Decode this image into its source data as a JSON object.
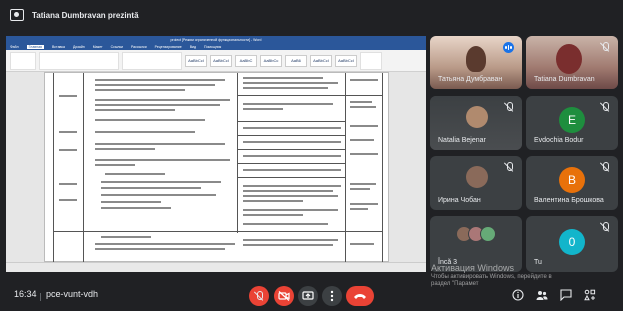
{
  "presenter": {
    "text": "Tatiana Dumbravan prezintă"
  },
  "shared_screen": {
    "word_title": "proiect [Режим ограниченной функциональности] - Word",
    "menu": [
      "Файл",
      "Главная",
      "Вставка",
      "Дизайн",
      "Макет",
      "Ссылки",
      "Рассылки",
      "Рецензирование",
      "Вид",
      "Помощник"
    ],
    "styles": [
      "AaBbCcI",
      "AaBbCcI",
      "AaBbC",
      "AaBbCc",
      "AaB6",
      "AaBbCcI",
      "AaBbCcI"
    ]
  },
  "participants": [
    {
      "name": "Татьяна Думбраван",
      "type": "video",
      "speaking": true
    },
    {
      "name": "Tatiana Dumbravan",
      "type": "video",
      "muted": true
    },
    {
      "name": "Natalia Bejenar",
      "type": "video",
      "muted": true
    },
    {
      "name": "Evdochia Bodur",
      "type": "avatar",
      "initial": "E",
      "color": "#1e8e3e",
      "muted": true
    },
    {
      "name": "Ирина Чобан",
      "type": "video",
      "muted": true
    },
    {
      "name": "Валентина Брошкова",
      "type": "avatar",
      "initial": "В",
      "color": "#e8710a",
      "muted": true
    },
    {
      "name": "Încă 3",
      "type": "group",
      "muted": false
    },
    {
      "name": "Tu",
      "type": "avatar",
      "initial": "0",
      "color": "#12b5cb",
      "muted": true
    }
  ],
  "meeting": {
    "time": "16:34",
    "code": "pce-vunt-vdh"
  },
  "watermark": {
    "title": "Активация Windows",
    "subtitle": "Чтобы активировать Windows, перейдите в",
    "subtitle2": "раздел \"Парамет"
  }
}
